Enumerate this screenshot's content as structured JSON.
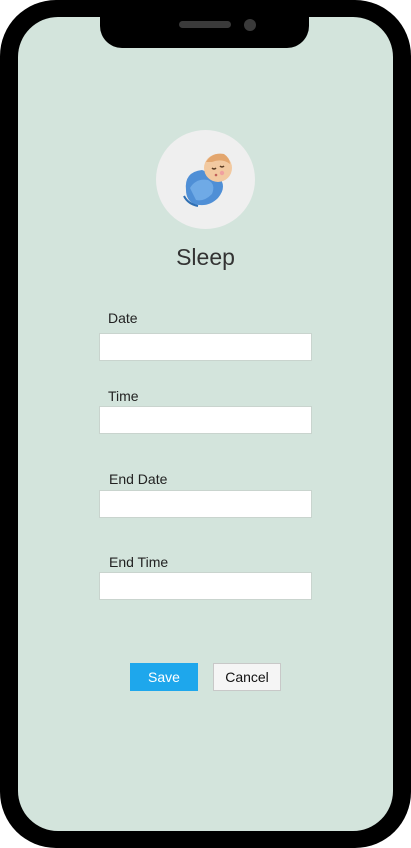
{
  "screen": {
    "title": "Sleep",
    "avatar_icon": "sleeping-baby-icon"
  },
  "form": {
    "fields": [
      {
        "label": "Date",
        "value": "",
        "placeholder": ""
      },
      {
        "label": "Time",
        "value": "",
        "placeholder": ""
      },
      {
        "label": "End Date",
        "value": "",
        "placeholder": ""
      },
      {
        "label": "End Time",
        "value": "",
        "placeholder": ""
      }
    ]
  },
  "actions": {
    "save_label": "Save",
    "cancel_label": "Cancel"
  },
  "colors": {
    "background": "#d3e4dc",
    "primary": "#1ea7ec",
    "frame": "#000000"
  }
}
